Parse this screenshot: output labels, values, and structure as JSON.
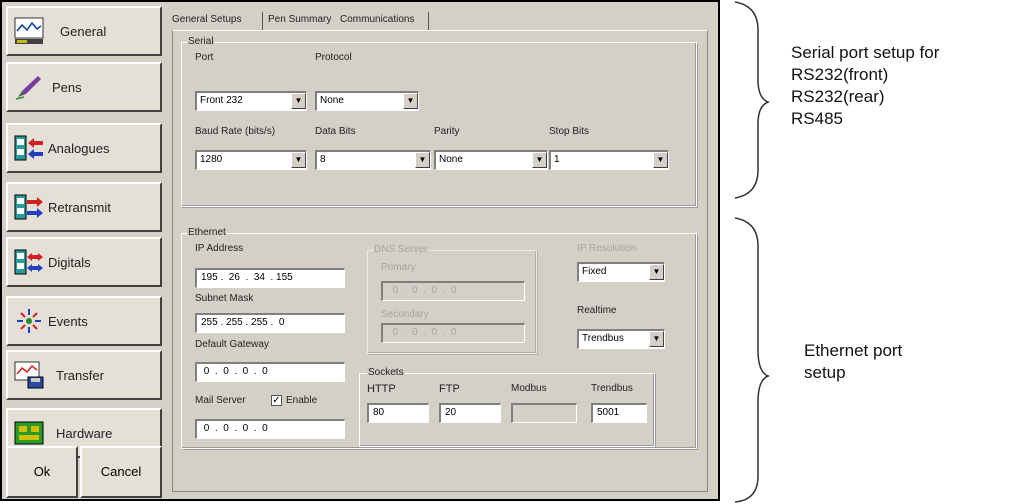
{
  "sidebar": {
    "items": [
      {
        "label": "General",
        "icon": "chart-icon"
      },
      {
        "label": "Pens",
        "icon": "pen-icon"
      },
      {
        "label": "Analogues",
        "icon": "analogue-arrow-icon"
      },
      {
        "label": "Retransmit",
        "icon": "retransmit-arrow-icon"
      },
      {
        "label": "Digitals",
        "icon": "digital-arrows-icon"
      },
      {
        "label": "Events",
        "icon": "events-icon"
      },
      {
        "label": "Transfer",
        "icon": "transfer-icon"
      },
      {
        "label": "Hardware",
        "icon": "hardware-board-icon"
      }
    ],
    "ok_label": "Ok",
    "cancel_label": "Cancel"
  },
  "tabs": [
    "General Setups",
    "Pen Summary",
    "Communications"
  ],
  "serial": {
    "group_label": "Serial",
    "port_label": "Port",
    "port_value": "Front 232",
    "protocol_label": "Protocol",
    "protocol_value": "None",
    "baud_label": "Baud Rate (bits/s)",
    "baud_value": "1280",
    "databits_label": "Data Bits",
    "databits_value": "8",
    "parity_label": "Parity",
    "parity_value": "None",
    "stopbits_label": "Stop Bits",
    "stopbits_value": "1"
  },
  "ethernet": {
    "group_label": "Ethernet",
    "ip_label": "IP Address",
    "ip_value": "195 .  26  .  34  . 155",
    "subnet_label": "Subnet Mask",
    "subnet_value": "255 . 255 . 255 .  0",
    "gateway_label": "Default Gateway",
    "gateway_value": " 0  .  0  .  0  .  0",
    "mail_label": "Mail Server",
    "enable_label": "Enable",
    "mail_value": " 0  .  0  .  0  .  0",
    "dns_label": "DNS Server",
    "primary_label": "Primary",
    "primary_value": "  0  .  0  .  0  .  0",
    "secondary_label": "Secondary",
    "secondary_value": "  0  .  0  .  0  .  0",
    "ipresolution_label": "IP Resolution",
    "ipresolution_value": "Fixed",
    "realtime_label": "Realtime",
    "realtime_value": "Trendbus",
    "sockets_label": "Sockets",
    "http_label": "HTTP",
    "http_value": "80",
    "ftp_label": "FTP",
    "ftp_value": "20",
    "modbus_label": "Modbus",
    "modbus_value": "",
    "trendbus_label": "Trendbus",
    "trendbus_value": "5001"
  },
  "annotations": {
    "serial_lines": [
      "Serial port setup for",
      "RS232(front)",
      "RS232(rear)",
      "RS485"
    ],
    "ethernet_lines": [
      "Ethernet port",
      "setup"
    ]
  },
  "colors": {
    "window_bg": "#d4d0c8",
    "button_face": "#e4e0d8"
  }
}
